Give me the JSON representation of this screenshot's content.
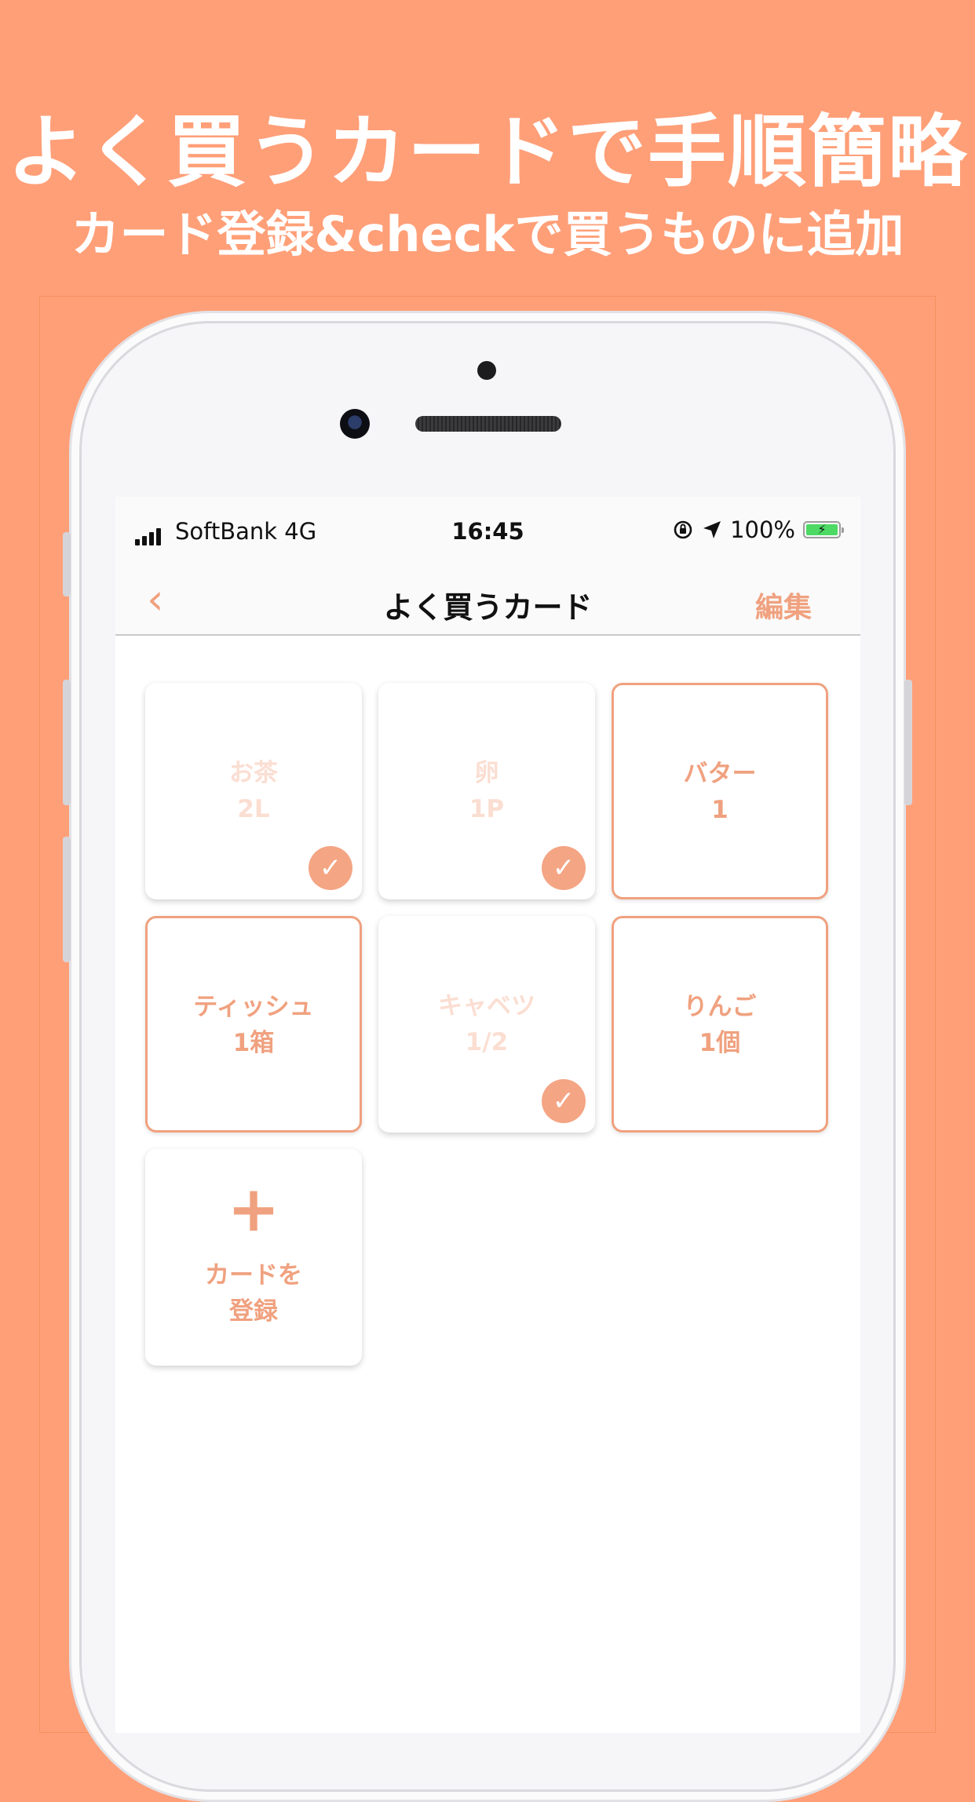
{
  "headline": {
    "title": "よく買うカードで手順簡略",
    "subtitle": "カード登録&checkで買うものに追加"
  },
  "status_bar": {
    "carrier": "SoftBank   4G",
    "time": "16:45",
    "battery_text": "100%"
  },
  "nav": {
    "back_glyph": "‹",
    "title": "よく買うカード",
    "edit_label": "編集"
  },
  "cards": [
    {
      "name": "お茶",
      "qty": "2L",
      "checked": true
    },
    {
      "name": "卵",
      "qty": "1P",
      "checked": true
    },
    {
      "name": "バター",
      "qty": "1",
      "checked": false
    },
    {
      "name": "ティッシュ",
      "qty": "1箱",
      "checked": false
    },
    {
      "name": "キャベツ",
      "qty": "1/2",
      "checked": true
    },
    {
      "name": "りんご",
      "qty": "1個",
      "checked": false
    }
  ],
  "add_card": {
    "icon": "+",
    "line1": "カードを",
    "line2": "登録"
  },
  "colors": {
    "background": "#ff9f78",
    "accent": "#f0a17f",
    "checked_text": "#fbded2",
    "battery_green": "#4cd964"
  },
  "icons": [
    "back-chevron-icon",
    "check-icon",
    "plus-icon",
    "location-arrow-icon",
    "rotation-lock-icon",
    "battery-icon",
    "signal-icon"
  ]
}
